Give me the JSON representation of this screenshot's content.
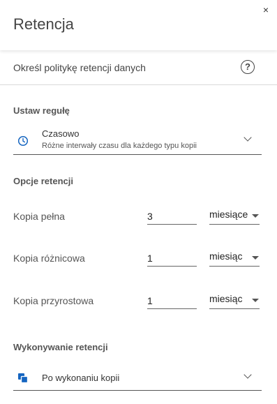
{
  "header": {
    "title": "Retencja",
    "close_glyph": "×"
  },
  "policy": {
    "heading": "Określ politykę retencji danych",
    "help_glyph": "?"
  },
  "rule": {
    "section_label": "Ustaw regułę",
    "selected_title": "Czasowo",
    "selected_description": "Różne interwały czasu dla każdego typu kopii",
    "icon": "clock-icon"
  },
  "options": {
    "section_label": "Opcje retencji",
    "rows": [
      {
        "label": "Kopia pełna",
        "value": "3",
        "unit": "miesiące"
      },
      {
        "label": "Kopia różnicowa",
        "value": "1",
        "unit": "miesiąc"
      },
      {
        "label": "Kopia przyrostowa",
        "value": "1",
        "unit": "miesiąc"
      }
    ]
  },
  "execution": {
    "section_label": "Wykonywanie retencji",
    "selected": "Po wykonaniu kopii",
    "icon": "copy-icon"
  },
  "colors": {
    "accent": "#1565c0",
    "text": "#333333",
    "divider": "#d9d9d9"
  }
}
